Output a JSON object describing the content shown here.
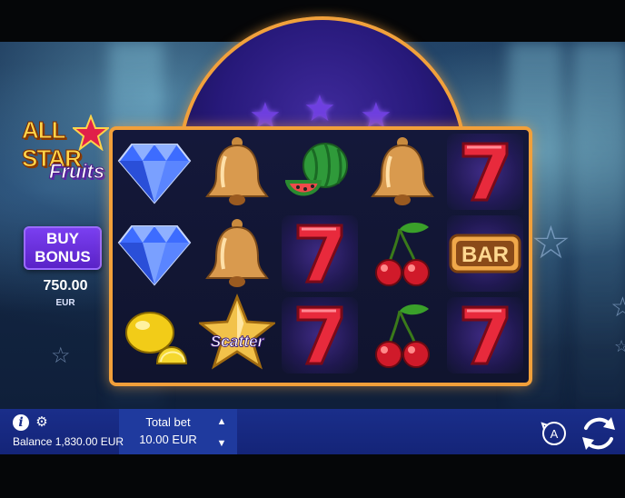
{
  "game": {
    "logo_line1": "ALL STAR",
    "logo_line2": "Fruits"
  },
  "buy_bonus": {
    "label_line1": "BUY",
    "label_line2": "BONUS",
    "price": "750.00",
    "currency": "EUR"
  },
  "reels": [
    [
      "diamond-icon",
      "bell-icon",
      "watermelon-icon",
      "bell-icon",
      "seven-icon"
    ],
    [
      "diamond-icon",
      "bell-icon",
      "seven-icon",
      "cherries-icon",
      "bar-icon"
    ],
    [
      "lemon-icon",
      "scatter-star-icon",
      "seven-icon",
      "cherries-icon",
      "seven-icon"
    ]
  ],
  "symbols": {
    "bar_label": "BAR",
    "scatter_label": "Scatter"
  },
  "footer": {
    "balance_text": "Balance 1,830.00 EUR",
    "total_bet_label": "Total bet",
    "total_bet_value": "10.00 EUR",
    "auto_label": "A"
  },
  "colors": {
    "frame": "#f2a03a",
    "accent_purple": "#6a30e0",
    "footer_blue": "#1a2e8a"
  }
}
